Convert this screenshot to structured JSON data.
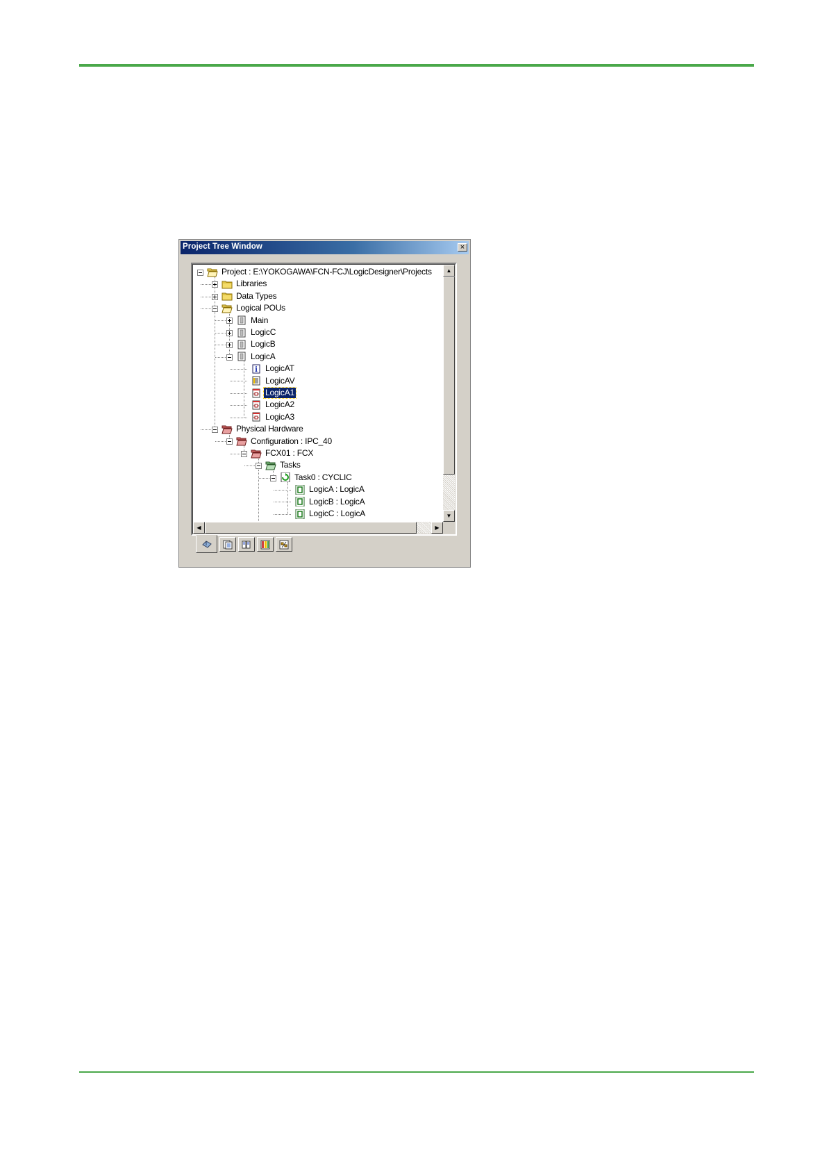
{
  "window": {
    "title": "Project Tree Window",
    "close_glyph": "×"
  },
  "tree": [
    {
      "label": "Project : E:\\YOKOGAWA\\FCN-FCJ\\LogicDesigner\\Projects",
      "level": 0,
      "icon": "folder-open-icon",
      "exp": "minus"
    },
    {
      "label": "Libraries",
      "level": 1,
      "icon": "folder-icon",
      "exp": "plus"
    },
    {
      "label": "Data Types",
      "level": 1,
      "icon": "folder-icon",
      "exp": "plus"
    },
    {
      "label": "Logical POUs",
      "level": 1,
      "icon": "folder-open-icon",
      "exp": "minus"
    },
    {
      "label": "Main",
      "level": 2,
      "icon": "pou-icon",
      "exp": "plus"
    },
    {
      "label": "LogicC",
      "level": 2,
      "icon": "pou-icon",
      "exp": "plus"
    },
    {
      "label": "LogicB",
      "level": 2,
      "icon": "pou-icon",
      "exp": "plus"
    },
    {
      "label": "LogicA",
      "level": 2,
      "icon": "pou-icon",
      "exp": "minus"
    },
    {
      "label": "LogicAT",
      "level": 3,
      "icon": "info-icon",
      "exp": ""
    },
    {
      "label": "LogicAV",
      "level": 3,
      "icon": "variables-icon",
      "exp": ""
    },
    {
      "label": "LogicA1",
      "level": 3,
      "icon": "worksheet-icon",
      "exp": "",
      "selected": true
    },
    {
      "label": "LogicA2",
      "level": 3,
      "icon": "worksheet-icon",
      "exp": ""
    },
    {
      "label": "LogicA3",
      "level": 3,
      "icon": "worksheet-icon",
      "exp": ""
    },
    {
      "label": "Physical Hardware",
      "level": 1,
      "icon": "hardware-folder-icon",
      "exp": "minus"
    },
    {
      "label": "Configuration : IPC_40",
      "level": 2,
      "icon": "hardware-folder-icon",
      "exp": "minus"
    },
    {
      "label": "FCX01 : FCX",
      "level": 3,
      "icon": "hardware-folder-icon",
      "exp": "minus"
    },
    {
      "label": "Tasks",
      "level": 4,
      "icon": "tasks-folder-icon",
      "exp": "minus"
    },
    {
      "label": "Task0 : CYCLIC",
      "level": 5,
      "icon": "cyclic-task-icon",
      "exp": "minus"
    },
    {
      "label": "LogicA : LogicA",
      "level": 6,
      "icon": "program-instance-icon",
      "exp": ""
    },
    {
      "label": "LogicB : LogicA",
      "level": 6,
      "icon": "program-instance-icon",
      "exp": ""
    },
    {
      "label": "LogicC : LogicA",
      "level": 6,
      "icon": "program-instance-icon",
      "exp": ""
    }
  ],
  "tabs": [
    {
      "name": "tab-project-tree",
      "icon": "project-tree-icon",
      "active": true
    },
    {
      "name": "tab-libraries",
      "icon": "library-icon",
      "active": false
    },
    {
      "name": "tab-help",
      "icon": "book-icon",
      "active": false
    },
    {
      "name": "tab-instance-tree",
      "icon": "instance-icon",
      "active": false
    },
    {
      "name": "tab-resources",
      "icon": "resource-icon",
      "active": false
    }
  ],
  "scrollbars": {
    "up": "▲",
    "down": "▼",
    "left": "◀",
    "right": "▶"
  }
}
